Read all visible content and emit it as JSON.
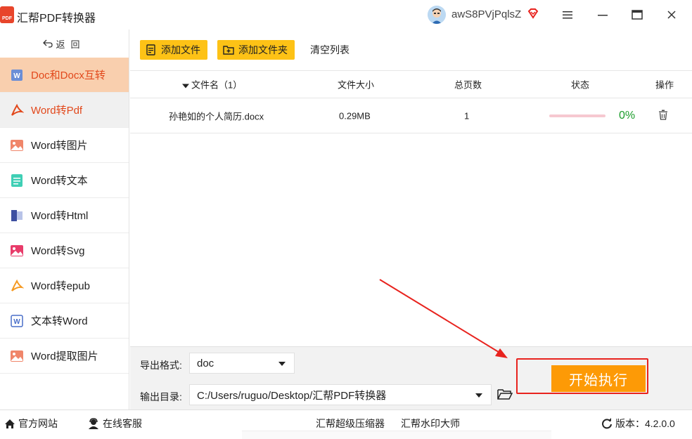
{
  "app": {
    "title": "汇帮PDF转换器",
    "logo_text": "PDF"
  },
  "user": {
    "name": "awS8PVjPqlsZ"
  },
  "sidebar": {
    "back_label": "返回",
    "items": [
      {
        "label": "Doc和Docx互转",
        "icon": "word-doc-icon"
      },
      {
        "label": "Word转Pdf",
        "icon": "acrobat-icon"
      },
      {
        "label": "Word转图片",
        "icon": "image-icon"
      },
      {
        "label": "Word转文本",
        "icon": "text-doc-icon"
      },
      {
        "label": "Word转Html",
        "icon": "html-doc-icon"
      },
      {
        "label": "Word转Svg",
        "icon": "svg-image-icon"
      },
      {
        "label": "Word转epub",
        "icon": "epub-icon"
      },
      {
        "label": "文本转Word",
        "icon": "word-icon"
      },
      {
        "label": "Word提取图片",
        "icon": "extract-image-icon"
      }
    ]
  },
  "toolbar": {
    "add_file": "添加文件",
    "add_folder": "添加文件夹",
    "clear_list": "清空列表"
  },
  "table": {
    "headers": {
      "filename": "文件名（1）",
      "size": "文件大小",
      "pages": "总页数",
      "status": "状态",
      "action": "操作"
    },
    "rows": [
      {
        "filename": "孙艳如的个人简历.docx",
        "size": "0.29MB",
        "pages": "1",
        "progress_text": "0%",
        "progress": 0
      }
    ]
  },
  "settings": {
    "format_label": "导出格式:",
    "format_value": "doc",
    "dir_label": "输出目录:",
    "dir_value": "C:/Users/ruguo/Desktop/汇帮PDF转换器",
    "start_label": "开始执行"
  },
  "footer": {
    "website": "官方网站",
    "support": "在线客服",
    "compressor": "汇帮超级压缩器",
    "watermark": "汇帮水印大师",
    "version": "版本：4.2.0.0"
  },
  "colors": {
    "accent": "#fd9a06",
    "active_bg": "#f9cfae",
    "active_text": "#e2481b",
    "highlight": "#e8231e",
    "button_yellow": "#fdc216"
  }
}
